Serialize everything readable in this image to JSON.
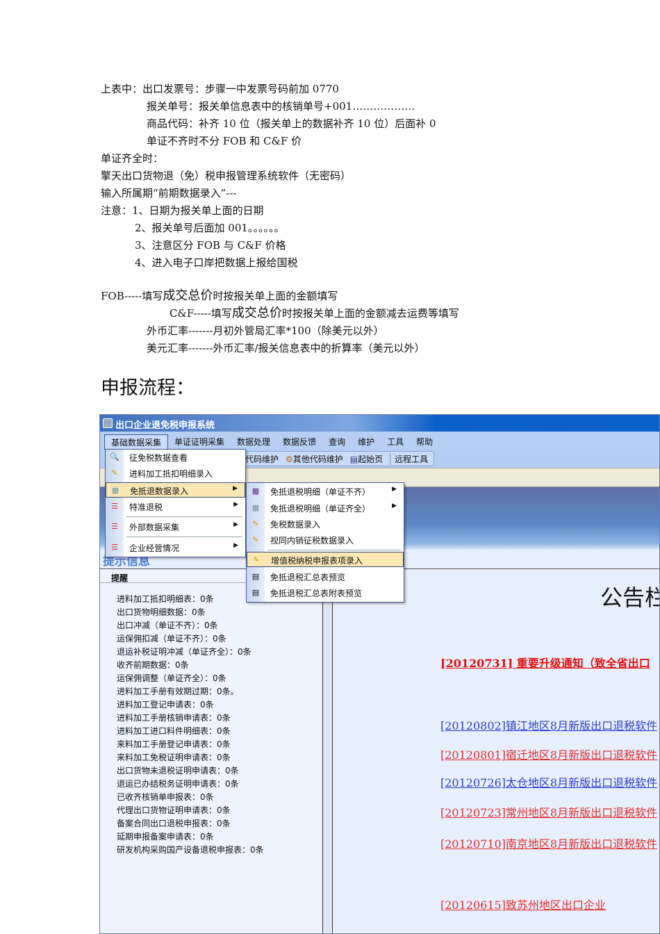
{
  "doc": {
    "lines": [
      "上表中：出口发票号：步骤一中发票号码前加 0770",
      "报关单号：报关单信息表中的核销单号+001………………",
      "商品代码：补齐 10 位（报关单上的数据补齐 10 位）后面补 0",
      "单证不齐时不分 FOB 和 C&F 价",
      "单证齐全时：",
      "擎天出口货物退（免）税申报管理系统软件（无密码）",
      "输入所属期“前期数据录入”---",
      "注意：1、日期为报关单上面的日期",
      "2、报关单号后面加 001。。。。。。",
      "3、注意区分 FOB 与 C&F 价格",
      "4、进入电子口岸把数据上报给国税"
    ],
    "fob": {
      "a": "FOB-----填写",
      "b": "成交总价",
      "c": "时按报关单上面的金额填写"
    },
    "cf": {
      "a": "C&F-----填写",
      "b": "成交总价",
      "c": "时按报关单上面的金额减去运费等填写"
    },
    "rate1": "外币汇率-------月初外管局汇率*100（除美元以外）",
    "rate2": "美元汇率-------外币汇率/报关信息表中的折算率（美元以外）",
    "heading": "申报流程："
  },
  "app": {
    "title": "出口企业退免税申报系统",
    "menus": [
      "基础数据采集",
      "单证证明采集",
      "数据处理",
      "数据反馈",
      "查询",
      "维护",
      "工具",
      "帮助"
    ],
    "toolbar": [
      "代码维护",
      "其他代码维护",
      "起始页",
      "远程工具"
    ],
    "tip_title": "提示信息",
    "remind": "提醒",
    "items": [
      "进料加工抵扣明细表：0条",
      "出口货物明细数据：0条",
      "出口冲减（单证不齐）：0条",
      "运保佣扣减（单证不齐）：0条",
      "退运补税证明冲减（单证齐全）：0条",
      "收齐前期数据：0条",
      "运保佣调整（单证齐全）：0条",
      "进料加工手册有效期过期：0条。",
      "进料加工登记申请表：0条",
      "进料加工手册核销申请表：0条",
      "进料加工进口料件明细表：0条",
      "来料加工手册登记申请表：0条",
      "来料加工免税证明申请表：0条",
      "出口货物未退税证明申请表：0条",
      "退运已办结税务证明申请表：0条",
      "已收齐核销单申报表：0条",
      "代理出口货物证明申请表：0条",
      "备案合同出口退税申报表：0条",
      "延期申报备案申请表：0条",
      "研发机构采购国产设备退税申报表：0条"
    ],
    "board_title": "公告栏",
    "notices": [
      {
        "text": "[20120731] 重要升级通知（致全省出口",
        "color": "#e01010"
      },
      {
        "text": "[20120802]镇江地区8月新版出口退税软件",
        "color": "#2a3fcf"
      },
      {
        "text": "[20120801]宿迁地区8月新版出口退税软件",
        "color": "#e03030"
      },
      {
        "text": "[20120726]太仓地区8月新版出口退税软件",
        "color": "#2a3fcf"
      },
      {
        "text": "[20120723]常州地区8月新版出口退税软件",
        "color": "#e03030"
      },
      {
        "text": "[20120710]南京地区8月新版出口退税软件",
        "color": "#e03030"
      },
      {
        "text": "[20120615]致苏州地区出口企业",
        "color": "#e03030"
      }
    ],
    "menu1": [
      "征免税数据查看",
      "进料加工抵扣明细录入",
      "免抵退数据录入",
      "特准退税",
      "外部数据采集",
      "企业经营情况"
    ],
    "menu2": [
      "免抵退税明细（单证不齐）",
      "免抵退税明细（单证齐全）",
      "免税数据录入",
      "视同内销征税数据录入",
      "增值税纳税申报表项录入",
      "免抵退税汇总表预览",
      "免抵退税汇总表附表预览"
    ]
  }
}
